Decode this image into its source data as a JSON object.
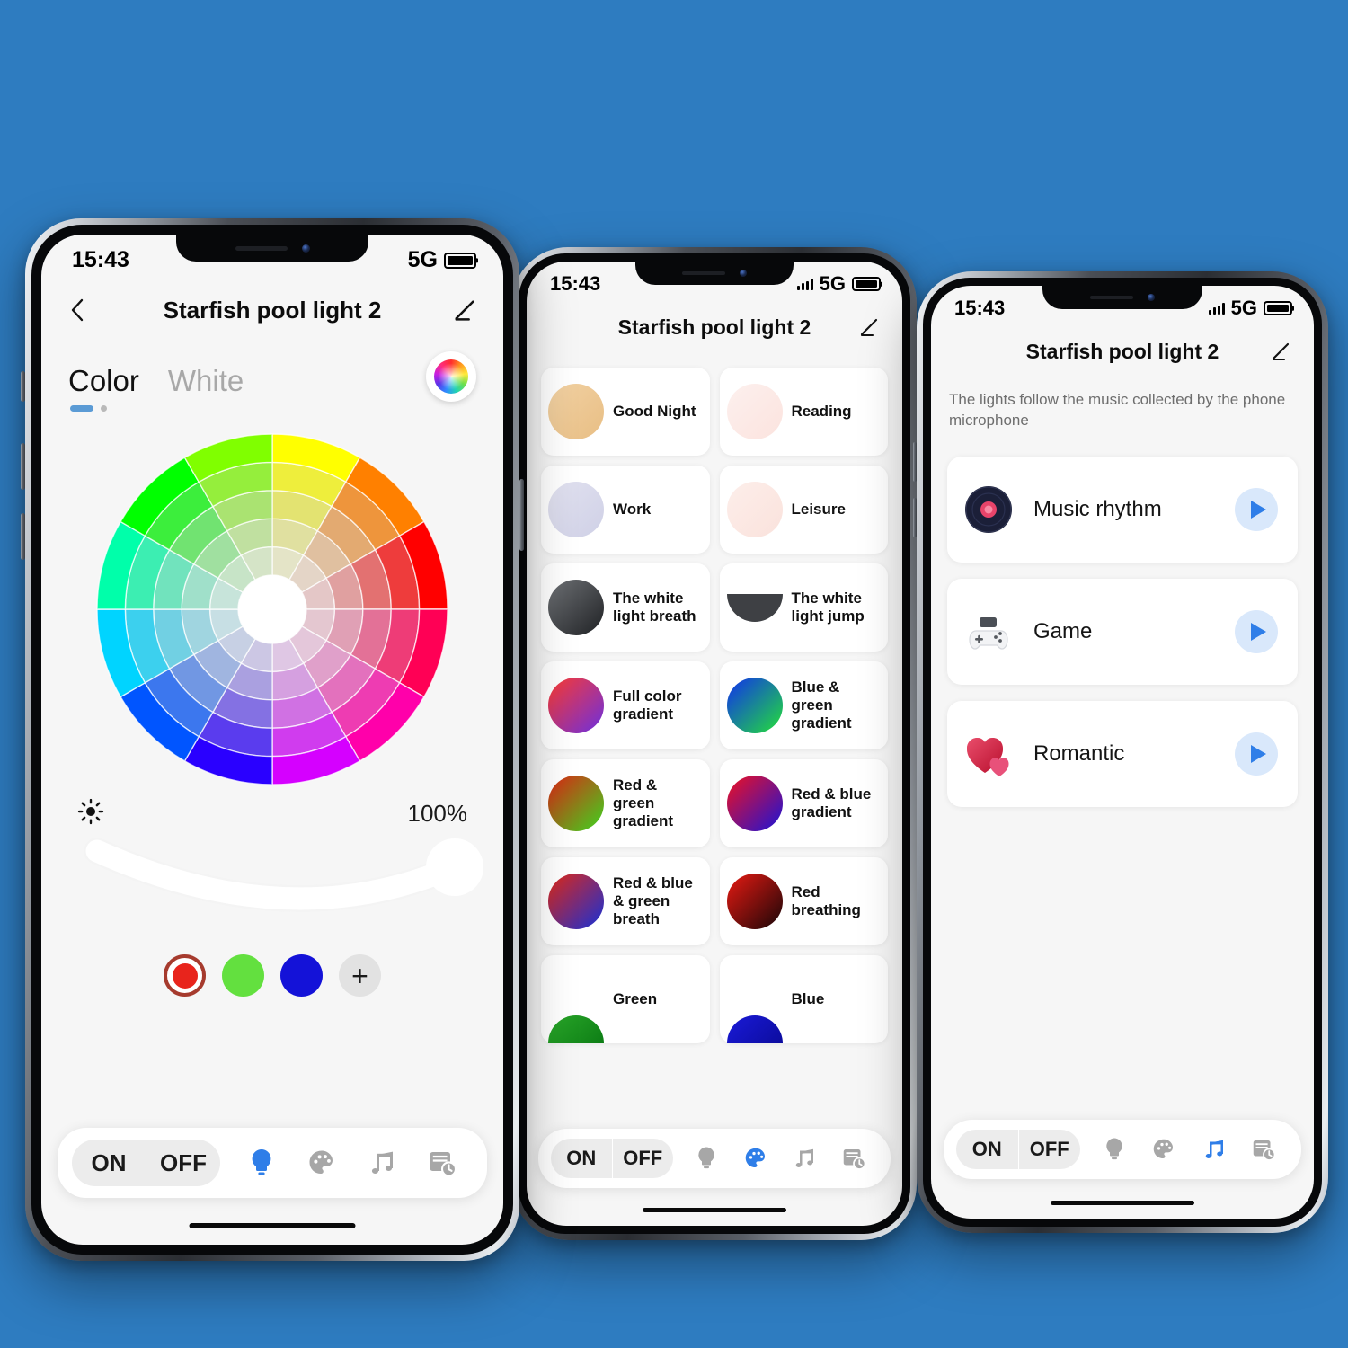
{
  "background_color": "#2e7cc0",
  "accent_color": "#2f7ee8",
  "phones": [
    {
      "id": "color-screen",
      "status_bar": {
        "time": "15:43",
        "network": "5G",
        "signal_icon": "signal-bars-icon",
        "battery_icon": "battery-icon"
      },
      "nav": {
        "back_icon": "chevron-left-icon",
        "title": "Starfish pool light 2",
        "edit_icon": "pencil-edit-icon"
      },
      "tabs": [
        {
          "label": "Color",
          "active": true
        },
        {
          "label": "White",
          "active": false
        }
      ],
      "color_wheel_badge_icon": "color-wheel-icon",
      "pagination": {
        "active_index": 0,
        "count": 2
      },
      "brightness": {
        "icon": "brightness-sun-icon",
        "value_label": "100%",
        "value": 100
      },
      "swatches": [
        {
          "name": "red",
          "color": "#e8241c",
          "selected": true
        },
        {
          "name": "green",
          "color": "#63e03f",
          "selected": false
        },
        {
          "name": "blue",
          "color": "#1412d8",
          "selected": false
        },
        {
          "name": "add",
          "color": "#e2e2e2",
          "selected": false,
          "label": "+"
        }
      ],
      "toolbar": {
        "on_label": "ON",
        "off_label": "OFF",
        "icons": [
          {
            "name": "bulb-icon",
            "active": true
          },
          {
            "name": "palette-icon",
            "active": false
          },
          {
            "name": "music-note-icon",
            "active": false
          },
          {
            "name": "timer-schedule-icon",
            "active": false
          }
        ]
      }
    },
    {
      "id": "scene-screen",
      "status_bar": {
        "time": "15:43",
        "network": "5G",
        "signal_icon": "signal-bars-icon",
        "battery_icon": "battery-icon"
      },
      "nav": {
        "title": "Starfish pool light 2",
        "edit_icon": "pencil-edit-icon"
      },
      "scenes": [
        {
          "label": "Good Night",
          "icon_style": "circle",
          "color_a": "#f2d2a4",
          "color_b": "#e8be84"
        },
        {
          "label": "Reading",
          "icon_style": "circle",
          "color_a": "#fdf0ee",
          "color_b": "#fbe3de"
        },
        {
          "label": "Work",
          "icon_style": "circle",
          "color_a": "#e2e2f0",
          "color_b": "#cfd0e6"
        },
        {
          "label": "Leisure",
          "icon_style": "circle",
          "color_a": "#fdeeea",
          "color_b": "#fae2dc"
        },
        {
          "label": "The white light breath",
          "icon_style": "circle",
          "color_a": "#6f7276",
          "color_b": "#1f2124"
        },
        {
          "label": "The white light jump",
          "icon_style": "half-bottom",
          "color_a": "#3e4044",
          "color_b": "#3e4044"
        },
        {
          "label": "Full color gradient",
          "icon_style": "circle",
          "color_a": "#ff3b2f",
          "color_b": "#6a2fe0"
        },
        {
          "label": "Blue & green gradient",
          "icon_style": "circle",
          "color_a": "#1030ee",
          "color_b": "#23e038"
        },
        {
          "label": "Red & green gradient",
          "icon_style": "circle",
          "color_a": "#e02314",
          "color_b": "#3bd61f"
        },
        {
          "label": "Red & blue gradient",
          "icon_style": "circle",
          "color_a": "#f01020",
          "color_b": "#1a14d8"
        },
        {
          "label": "Red & blue & green breath",
          "icon_style": "circle",
          "color_a": "#e42814",
          "color_b": "#1430d8"
        },
        {
          "label": "Red breathing",
          "icon_style": "circle",
          "color_a": "#e81a12",
          "color_b": "#180608"
        },
        {
          "label": "Green",
          "icon_style": "half-top",
          "color_a": "#2aa82a",
          "color_b": "#0d7d15"
        },
        {
          "label": "Blue",
          "icon_style": "half-top",
          "color_a": "#1a1ad8",
          "color_b": "#0c0c9e"
        }
      ],
      "toolbar": {
        "on_label": "ON",
        "off_label": "OFF",
        "icons": [
          {
            "name": "bulb-icon",
            "active": false
          },
          {
            "name": "palette-icon",
            "active": true
          },
          {
            "name": "music-note-icon",
            "active": false
          },
          {
            "name": "timer-schedule-icon",
            "active": false
          }
        ]
      }
    },
    {
      "id": "music-screen",
      "status_bar": {
        "time": "15:43",
        "network": "5G",
        "signal_icon": "signal-bars-icon",
        "battery_icon": "battery-icon"
      },
      "nav": {
        "title": "Starfish pool light 2",
        "edit_icon": "pencil-edit-icon"
      },
      "description": "The lights follow the music collected by the phone microphone",
      "modes": [
        {
          "label": "Music rhythm",
          "icon": "vinyl-record-icon",
          "play_icon": "play-icon"
        },
        {
          "label": "Game",
          "icon": "gamepad-icon",
          "play_icon": "play-icon"
        },
        {
          "label": "Romantic",
          "icon": "hearts-icon",
          "play_icon": "play-icon"
        }
      ],
      "toolbar": {
        "on_label": "ON",
        "off_label": "OFF",
        "icons": [
          {
            "name": "bulb-icon",
            "active": false
          },
          {
            "name": "palette-icon",
            "active": false
          },
          {
            "name": "music-note-icon",
            "active": true
          },
          {
            "name": "timer-schedule-icon",
            "active": false
          }
        ]
      }
    }
  ]
}
